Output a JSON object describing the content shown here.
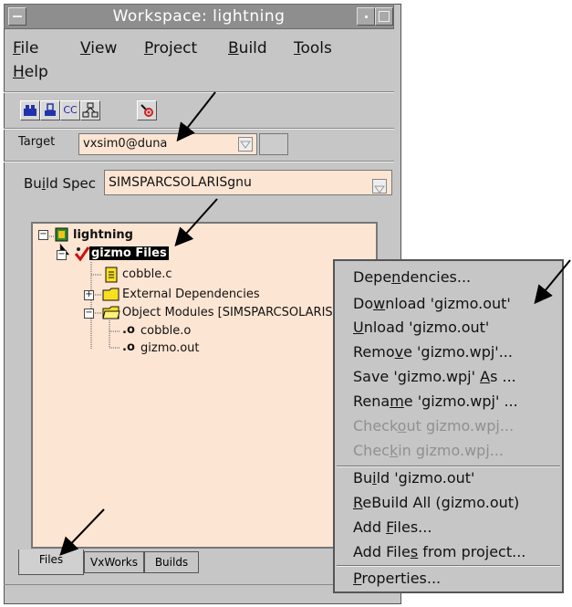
{
  "window": {
    "title": "Workspace: lightning"
  },
  "menu": [
    {
      "label": "File",
      "u": "F",
      "rest": "ile"
    },
    {
      "label": "View",
      "u": "V",
      "rest": "iew"
    },
    {
      "label": "Project",
      "u": "P",
      "rest": "roject"
    },
    {
      "label": "Build",
      "u": "B",
      "rest": "uild"
    },
    {
      "label": "Tools",
      "u": "T",
      "rest": "ools"
    },
    {
      "label": "Help",
      "u": "H",
      "rest": "elp"
    }
  ],
  "toolbar": {
    "cc_label": "CC"
  },
  "target": {
    "label": "Target",
    "value": "vxsim0@duna"
  },
  "build_spec": {
    "label_pre": "Bu",
    "label_u": "i",
    "label_post": "ld Spec",
    "value": "SIMSPARCSOLARISgnu"
  },
  "tree": {
    "root": "lightning",
    "project": "gizmo Files",
    "file1": "cobble.c",
    "ext_deps": "External Dependencies",
    "obj_modules": "Object Modules [SIMSPARCSOLARISg",
    "obj1": "cobble.o",
    "obj2": "gizmo.out"
  },
  "tabs": [
    "Files",
    "VxWorks",
    "Builds"
  ],
  "context_menu": {
    "items": [
      {
        "pre": "Depe",
        "u": "n",
        "post": "dencies...",
        "enabled": true
      },
      {
        "pre": "Do",
        "u": "w",
        "post": "nload 'gizmo.out'",
        "enabled": true
      },
      {
        "pre": "",
        "u": "U",
        "post": "nload 'gizmo.out'",
        "enabled": true
      },
      {
        "pre": "Remo",
        "u": "v",
        "post": "e 'gizmo.wpj'...",
        "enabled": true
      },
      {
        "pre": "Save 'gizmo.wpj' ",
        "u": "A",
        "post": "s ...",
        "enabled": true
      },
      {
        "pre": "Rena",
        "u": "m",
        "post": "e 'gizmo.wpj' ...",
        "enabled": true
      },
      {
        "pre": "Check",
        "u": "o",
        "post": "ut  gizmo.wpj...",
        "enabled": false
      },
      {
        "pre": "Chec",
        "u": "k",
        "post": "in gizmo.wpj...",
        "enabled": false
      },
      {
        "pre": "Bu",
        "u": "i",
        "post": "ld 'gizmo.out'",
        "enabled": true
      },
      {
        "pre": "",
        "u": "R",
        "post": "eBuild All (gizmo.out)",
        "enabled": true
      },
      {
        "pre": "Add ",
        "u": "F",
        "post": "iles...",
        "enabled": true
      },
      {
        "pre": "Add File",
        "u": "s",
        "post": " from project...",
        "enabled": true
      },
      {
        "pre": "",
        "u": "P",
        "post": "roperties...",
        "enabled": true
      }
    ]
  }
}
